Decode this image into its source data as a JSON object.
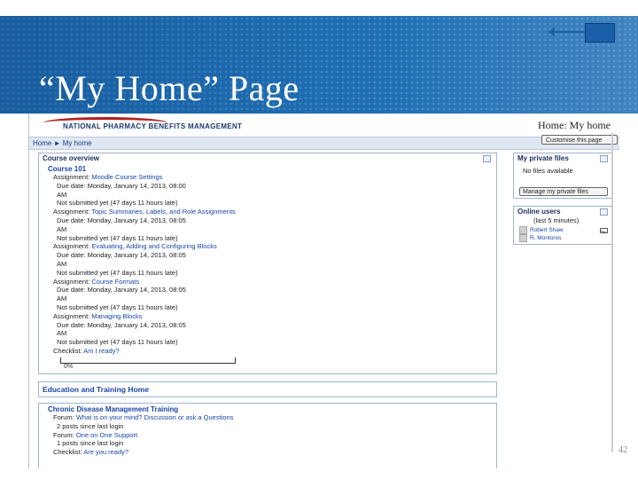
{
  "slide": {
    "title": "“My Home” Page",
    "page_number": "42"
  },
  "site": {
    "logo_text": "NATIONAL PHARMACY BENEFITS MANAGEMENT",
    "page_heading": "Home: My home"
  },
  "nav": {
    "breadcrumb": "Home ► My home",
    "customise_label": "Customise this page"
  },
  "course_overview": {
    "title": "Course overview",
    "course_name": "Course 101",
    "lines": [
      {
        "label": "Assignment: ",
        "link": "Moodle Course Settings"
      },
      {
        "label": "Due date: Monday, January 14, 2013, 08:00",
        "link": ""
      },
      {
        "label": "AM",
        "link": ""
      },
      {
        "label": "Not submitted yet (47 days 11 hours late)",
        "link": ""
      },
      {
        "label": "Assignment: ",
        "link": "Topic Summaries, Labels, and Role Assignments"
      },
      {
        "label": "Due date: Monday, January 14, 2013, 08:05",
        "link": ""
      },
      {
        "label": "AM",
        "link": ""
      },
      {
        "label": "Not submitted yet (47 days 11 hours late)",
        "link": ""
      },
      {
        "label": "Assignment: ",
        "link": "Evaluating, Adding and Configuring Blocks"
      },
      {
        "label": "Due date: Monday, January 14, 2013, 08:05",
        "link": ""
      },
      {
        "label": "AM",
        "link": ""
      },
      {
        "label": "Not submitted yet (47 days 11 hours late)",
        "link": ""
      },
      {
        "label": "Assignment: ",
        "link": "Course Formats"
      },
      {
        "label": "Due date: Monday, January 14, 2013, 08:05",
        "link": ""
      },
      {
        "label": "AM",
        "link": ""
      },
      {
        "label": "Not submitted yet (47 days 11 hours late)",
        "link": ""
      },
      {
        "label": "Assignment: ",
        "link": "Managing Blocks"
      },
      {
        "label": "Due date: Monday, January 14, 2013, 08:05",
        "link": ""
      },
      {
        "label": "AM",
        "link": ""
      },
      {
        "label": "Not submitted yet (47 days 11 hours late)",
        "link": ""
      },
      {
        "label": "Checklist: ",
        "link": "Am I ready?"
      }
    ],
    "progress_percent": "0%"
  },
  "education_block": {
    "title": "Education and Training Home"
  },
  "chronic_block": {
    "title": "Chronic Disease Management Training",
    "lines": [
      {
        "label": "Forum: ",
        "link": "What is on your mind? Discussion or ask a Questions"
      },
      {
        "label": "2 posts since last login",
        "link": ""
      },
      {
        "label": "Forum: ",
        "link": "One on One Support"
      },
      {
        "label": "1 posts since last login",
        "link": ""
      },
      {
        "label": "Checklist: ",
        "link": "Are you ready?"
      }
    ]
  },
  "private_files": {
    "title": "My private files",
    "empty_text": "No files available",
    "manage_label": "Manage my private files"
  },
  "online_users": {
    "title": "Online users",
    "subtitle": "(last 5 minutes)",
    "users": [
      "Robert Shaw",
      "R. Montoros"
    ]
  },
  "colors": {
    "header_blue": "#1f6fb5",
    "link_blue": "#1a45a8",
    "arrow_blue": "#1a5fa8"
  }
}
